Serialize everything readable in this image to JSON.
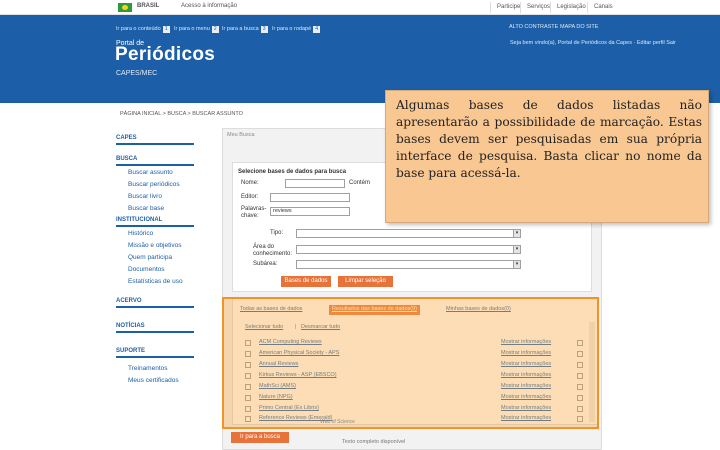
{
  "govbar": {
    "country": "BRASIL",
    "access_info": "Acesso à informação",
    "links": [
      "Participe",
      "Serviços",
      "Legislação",
      "Canais"
    ]
  },
  "header": {
    "shortcuts": [
      {
        "label": "Ir para o conteúdo",
        "key": "1"
      },
      {
        "label": "Ir para o menu",
        "key": "2"
      },
      {
        "label": "Ir para a busca",
        "key": "3"
      },
      {
        "label": "Ir para o rodapé",
        "key": "4"
      }
    ],
    "top_links": [
      "ALTO CONTRASTE",
      "MAPA DO SITE"
    ],
    "portal_prefix": "Portal de",
    "title": "Periódicos",
    "subtitle": "CAPES/MEC",
    "welcome": "Seja bem vindo(a), Portal de Periódicos da Capes · Editar perfil Sair"
  },
  "breadcrumb": "PÁGINA INICIAL > BUSCA > BUSCAR ASSUNTO",
  "nav": {
    "sections": [
      {
        "head": "CAPES",
        "items": []
      },
      {
        "head": "BUSCA",
        "items": [
          "Buscar assunto",
          "Buscar periódicos",
          "Buscar livro",
          "Buscar base"
        ]
      },
      {
        "head": "INSTITUCIONAL",
        "items": [
          "Histórico",
          "Missão e objetivos",
          "Quem participa",
          "Documentos",
          "Estatísticas de uso"
        ]
      },
      {
        "head": "ACERVO",
        "items": []
      },
      {
        "head": "NOTÍCIAS",
        "items": []
      },
      {
        "head": "SUPORTE",
        "items": [
          "Treinamentos",
          "Meus certificados"
        ]
      }
    ]
  },
  "main": {
    "label": "Meu Busca",
    "form": {
      "title": "Selecione bases de dados para busca",
      "labels": {
        "name": "Nome:",
        "publisher": "Editor:",
        "keywords": "Palavras-chave:",
        "type": "Tipo:",
        "area": "Área do conhecimento:",
        "subarea": "Subárea:"
      },
      "contains": "Contém",
      "keyword_value": "reviews",
      "search_button": "Bases de dados",
      "clear_button": "Limpar seleção"
    },
    "tabs": [
      "Todas as bases de dados",
      "Resultados das bases de dados(9)",
      "Minhas bases de dados(0)"
    ],
    "select_all": "Selecionar tudo",
    "deselect_all": "Desmarcar tudo",
    "results": [
      "ACM Computing Reviews",
      "American Physical Society - APS",
      "Annual Reviews",
      "Kirkus Reviews - ASP (EBSCO)",
      "MathSci (AMS)",
      "Nature (NPG)",
      "Primo Central (Ex Libris)",
      "Reference Reviews (Emerald)"
    ],
    "more_info": "Mostrar informações",
    "bottom_button": "Ir para a busca",
    "bottom_text": "Web of Science",
    "bottom_text2": "Texto completo disponível"
  },
  "callout": {
    "text": "Algumas bases de dados listadas não apresentarão a possibilidade de marcação. Estas bases devem ser pesquisadas em sua própria interface de pesquisa. Basta clicar no nome da base para acessá-la."
  },
  "colors": {
    "header_blue": "#1c5fa8",
    "accent_orange": "#e8733a",
    "callout_bg": "#f9c792",
    "highlight_border": "#f39226"
  }
}
